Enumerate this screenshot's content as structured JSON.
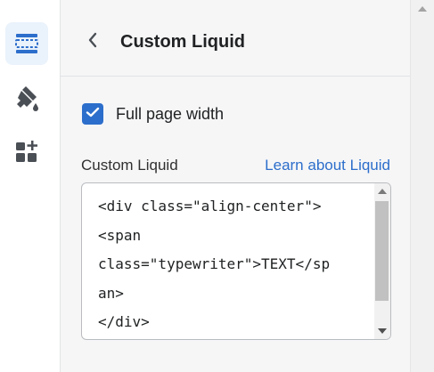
{
  "rail": {
    "items": [
      {
        "name": "sections",
        "icon": "sections-icon",
        "active": true
      },
      {
        "name": "theme-settings",
        "icon": "paint-brush-icon",
        "active": false
      },
      {
        "name": "apps",
        "icon": "apps-add-icon",
        "active": false
      }
    ]
  },
  "panel": {
    "title": "Custom Liquid",
    "back_icon": "chevron-left-icon"
  },
  "settings": {
    "full_width": {
      "label": "Full page width",
      "checked": true
    },
    "custom_liquid": {
      "label": "Custom Liquid",
      "help_link": "Learn about Liquid",
      "value": "<div class=\"align-center\">\n<span\nclass=\"typewriter\">TEXT</sp\nan>\n</div>"
    }
  },
  "colors": {
    "accent": "#2c6ecb",
    "active_rail_bg": "#eaf2fb",
    "panel_bg": "#f6f6f7"
  }
}
